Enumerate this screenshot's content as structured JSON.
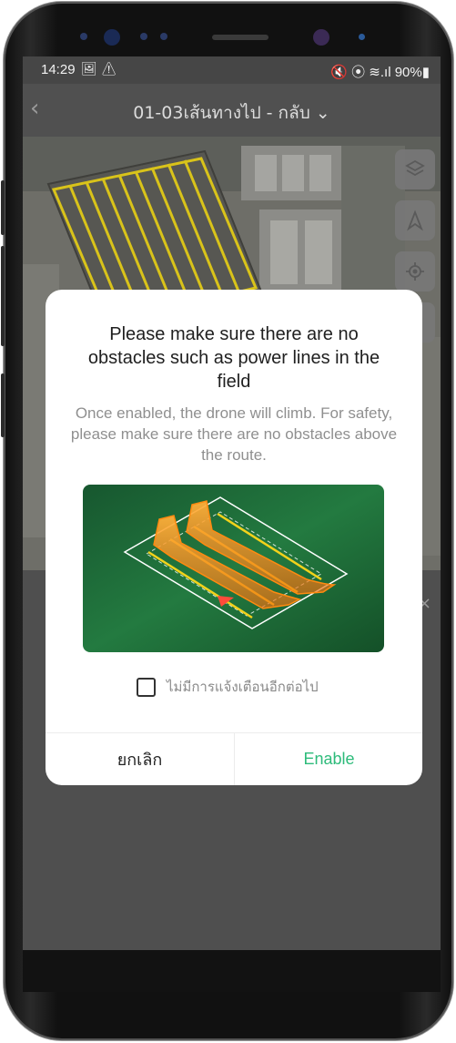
{
  "status_bar": {
    "time": "14:29",
    "left_icons": "🖼 ⚠",
    "right": "🔇 ⦿ ≋.ıl 90%▮"
  },
  "app_bar": {
    "back_icon": "chevron-left-icon",
    "title": "01-03เส้นทางไป - กลับ ⌄"
  },
  "map_tools": [
    "layers-icon",
    "navigation-arrow-icon",
    "locate-icon",
    "edit-icon"
  ],
  "dialog": {
    "title": "Please make sure there are no obstacles such as power lines in the field",
    "description": "Once enabled, the drone will climb. For safety, please make sure there are no obstacles above the route.",
    "dont_show_again": "ไม่มีการแจ้งเตือนอีกต่อไป",
    "checkbox_checked": false,
    "cancel_label": "ยกเลิก",
    "enable_label": "Enable"
  },
  "close_icon_char": "×",
  "colors": {
    "accent_green": "#2dbb7a",
    "field_green": "#1f6b3a",
    "route_yellow": "#f2d21b",
    "obstacle_orange": "#f58220"
  }
}
